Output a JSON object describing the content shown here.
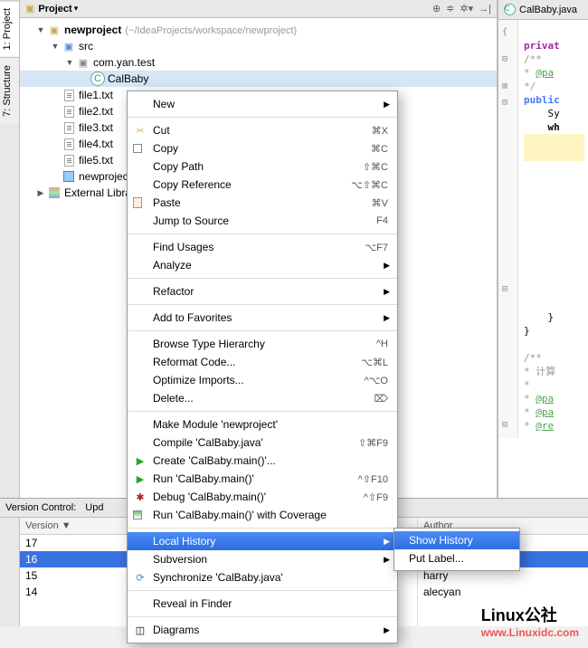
{
  "sidebar_tabs": {
    "project": "1: Project",
    "structure": "7: Structure"
  },
  "panel": {
    "title": "Project",
    "tools": [
      "target",
      "sort",
      "gear",
      "collapse",
      "close"
    ]
  },
  "tree": {
    "root": {
      "name": "newproject",
      "path": "(~/IdeaProjects/workspace/newproject)"
    },
    "src": "src",
    "pkg": "com.yan.test",
    "cls": "CalBaby",
    "files": [
      "file1.txt",
      "file2.txt",
      "file3.txt",
      "file4.txt",
      "file5.txt"
    ],
    "iml": "newproject.",
    "libs": "External Librarie"
  },
  "editor": {
    "tab": "CalBaby.java",
    "lines": {
      "l_private": "privat",
      "l_doc1": "/**",
      "l_doc2": " * @pa",
      "l_doc3": " */",
      "l_public": "public",
      "l_sy": "Sy",
      "l_wh": "wh",
      "l_brace": "}",
      "l_doc4": "/**",
      "l_doc5": " * 计算",
      "l_doc6": " *",
      "l_doc7": " * @pa",
      "l_doc8": " * @pa",
      "l_doc9": " * @re"
    }
  },
  "ctx_menu": [
    {
      "label": "New",
      "submenu": true
    },
    {
      "sep": true
    },
    {
      "label": "Cut",
      "shortcut": "⌘X",
      "icon": "cut"
    },
    {
      "label": "Copy",
      "shortcut": "⌘C",
      "icon": "copy"
    },
    {
      "label": "Copy Path",
      "shortcut": "⇧⌘C"
    },
    {
      "label": "Copy Reference",
      "shortcut": "⌥⇧⌘C"
    },
    {
      "label": "Paste",
      "shortcut": "⌘V",
      "icon": "paste"
    },
    {
      "label": "Jump to Source",
      "shortcut": "F4"
    },
    {
      "sep": true
    },
    {
      "label": "Find Usages",
      "shortcut": "⌥F7"
    },
    {
      "label": "Analyze",
      "submenu": true
    },
    {
      "sep": true
    },
    {
      "label": "Refactor",
      "submenu": true
    },
    {
      "sep": true
    },
    {
      "label": "Add to Favorites",
      "submenu": true
    },
    {
      "sep": true
    },
    {
      "label": "Browse Type Hierarchy",
      "shortcut": "^H"
    },
    {
      "label": "Reformat Code...",
      "shortcut": "⌥⌘L"
    },
    {
      "label": "Optimize Imports...",
      "shortcut": "^⌥O"
    },
    {
      "label": "Delete...",
      "shortcut": "⌦"
    },
    {
      "sep": true
    },
    {
      "label": "Make Module 'newproject'"
    },
    {
      "label": "Compile 'CalBaby.java'",
      "shortcut": "⇧⌘F9"
    },
    {
      "label": "Create 'CalBaby.main()'...",
      "icon": "run"
    },
    {
      "label": "Run 'CalBaby.main()'",
      "shortcut": "^⇧F10",
      "icon": "run"
    },
    {
      "label": "Debug 'CalBaby.main()'",
      "shortcut": "^⇧F9",
      "icon": "debug"
    },
    {
      "label": "Run 'CalBaby.main()' with Coverage",
      "icon": "cov"
    },
    {
      "sep": true
    },
    {
      "label": "Local History",
      "submenu": true,
      "hover": true
    },
    {
      "label": "Subversion",
      "submenu": true
    },
    {
      "label": "Synchronize 'CalBaby.java'",
      "icon": "sync"
    },
    {
      "sep": true
    },
    {
      "label": "Reveal in Finder"
    },
    {
      "sep": true
    },
    {
      "label": "Diagrams",
      "submenu": true,
      "icon": "diag"
    }
  ],
  "submenu": [
    "Show History",
    "Put Label..."
  ],
  "vc": {
    "header": [
      "Version Control:",
      "Upd"
    ],
    "col_version": "Version",
    "col_author": "Author",
    "rows": [
      {
        "v": "17",
        "a": ""
      },
      {
        "v": "16",
        "a": "",
        "sel": true
      },
      {
        "v": "15",
        "a": "harry"
      },
      {
        "v": "14",
        "a": "alecyan"
      }
    ]
  },
  "watermark": {
    "cn": "Linux公社",
    "url": "www.Linuxidc.com"
  }
}
